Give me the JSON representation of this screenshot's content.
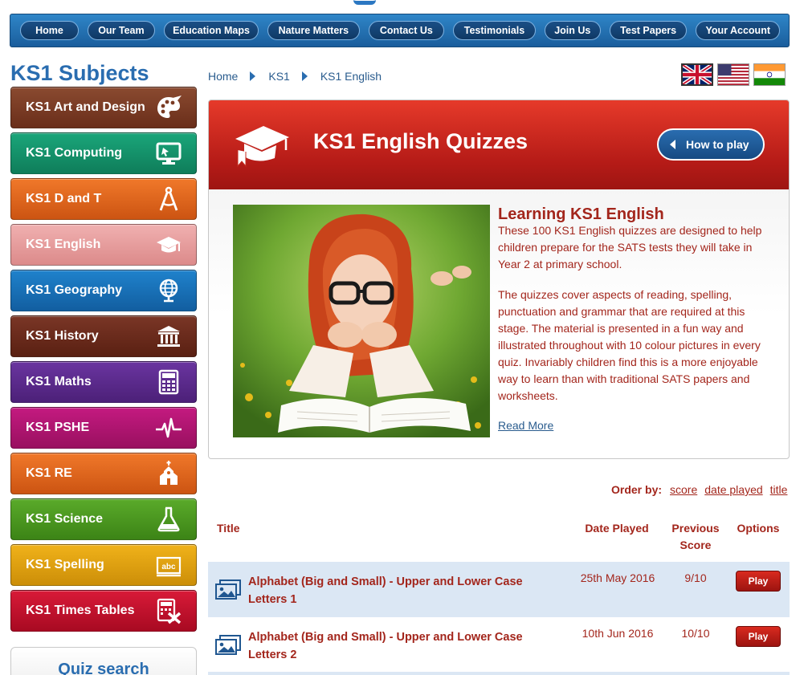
{
  "nav": {
    "items": [
      {
        "label": "Home",
        "width": 74
      },
      {
        "label": "Our Team",
        "width": 85
      },
      {
        "label": "Education Maps",
        "width": 120
      },
      {
        "label": "Nature Matters",
        "width": 116
      },
      {
        "label": "Contact Us",
        "width": 96
      },
      {
        "label": "Testimonials",
        "width": 104
      },
      {
        "label": "Join Us",
        "width": 71
      },
      {
        "label": "Test Papers",
        "width": 98
      },
      {
        "label": "Your Account",
        "width": 106
      }
    ]
  },
  "sidebar": {
    "title": "KS1 Subjects",
    "subjects": [
      {
        "label": "KS1 Art and Design",
        "icon": "palette-icon",
        "color": "#7a3a22"
      },
      {
        "label": "KS1 Computing",
        "icon": "computer-icon",
        "color": "#15926b"
      },
      {
        "label": "KS1 D and T",
        "icon": "compass-icon",
        "color": "#e0661a"
      },
      {
        "label": "KS1 English",
        "icon": "graduation-cap-icon",
        "color": "#e89a9a"
      },
      {
        "label": "KS1 Geography",
        "icon": "globe-icon",
        "color": "#1a6fb8"
      },
      {
        "label": "KS1 History",
        "icon": "museum-icon",
        "color": "#6a2a1c"
      },
      {
        "label": "KS1 Maths",
        "icon": "calculator-icon",
        "color": "#5b2a8e"
      },
      {
        "label": "KS1 PSHE",
        "icon": "heartbeat-icon",
        "color": "#b0146e"
      },
      {
        "label": "KS1 RE",
        "icon": "church-icon",
        "color": "#e0661a"
      },
      {
        "label": "KS1 Science",
        "icon": "flask-icon",
        "color": "#4e9a22"
      },
      {
        "label": "KS1 Spelling",
        "icon": "abc-board-icon",
        "color": "#e0a312"
      },
      {
        "label": "KS1 Times Tables",
        "icon": "times-table-icon",
        "color": "#c8102e"
      }
    ],
    "quiz_search": "Quiz search"
  },
  "breadcrumb": [
    "Home",
    "KS1",
    "KS1 English"
  ],
  "flags": [
    "uk-flag-icon",
    "us-flag-icon",
    "india-flag-icon"
  ],
  "banner": {
    "title": "KS1 English Quizzes",
    "how_to_play": "How to play"
  },
  "intro": {
    "heading": "Learning KS1 English",
    "para1": "These 100 KS1 English quizzes are designed to help children prepare for the SATS tests they will take in Year 2 at primary school.",
    "para2": "The quizzes cover aspects of reading, spelling, punctuation and grammar that are required at this stage. The material is presented in a fun way and illustrated throughout with 10 colour pictures in every quiz. Invariably children find this is a more enjoyable way to learn than with traditional SATS papers and worksheets.",
    "read_more": "Read More"
  },
  "order_by": {
    "label": "Order by:",
    "options": [
      "score",
      "date played",
      "title"
    ]
  },
  "table": {
    "headers": {
      "title": "Title",
      "date": "Date Played",
      "score": "Previous Score",
      "options": "Options"
    },
    "rows": [
      {
        "title": "Alphabet (Big and Small) - Upper and Lower Case Letters 1",
        "date": "25th May 2016",
        "score": "9/10",
        "action": "Play"
      },
      {
        "title": "Alphabet (Big and Small) - Upper and Lower Case Letters 2",
        "date": "10th Jun 2016",
        "score": "10/10",
        "action": "Play"
      }
    ]
  }
}
